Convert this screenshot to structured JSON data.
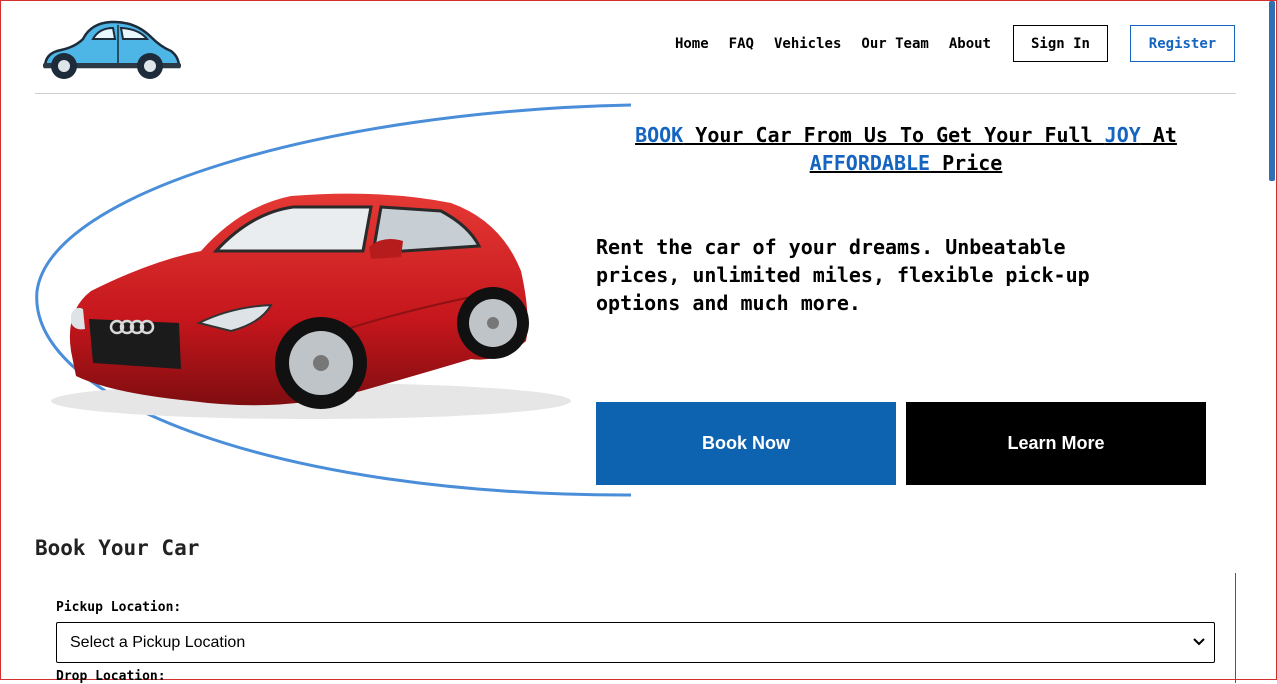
{
  "nav": {
    "links": [
      "Home",
      "FAQ",
      "Vehicles",
      "Our Team",
      "About"
    ],
    "sign_in": "Sign In",
    "register": "Register"
  },
  "hero": {
    "headline": {
      "w1": "BOOK",
      "t1": " Your Car From Us To Get Your Full ",
      "w2": "JOY",
      "t2": " At ",
      "w3": "AFFORDABLE",
      "t3": " Price"
    },
    "tagline": "Rent the car of your dreams. Unbeatable prices, unlimited miles, flexible pick-up options and much more.",
    "book_now": "Book Now",
    "learn_more": "Learn More"
  },
  "booking": {
    "title": "Book Your Car",
    "pickup_label": "Pickup Location:",
    "pickup_value": "Select a Pickup Location",
    "drop_label": "Drop Location:"
  },
  "colors": {
    "accent": "#1565c0",
    "button_blue": "#0e63b0",
    "car_red": "#c4161c",
    "logo_car": "#4db6e6"
  },
  "icons": {
    "logo": "beetle-car-logo",
    "hero": "red-sports-car",
    "select": "chevron-down-icon"
  }
}
